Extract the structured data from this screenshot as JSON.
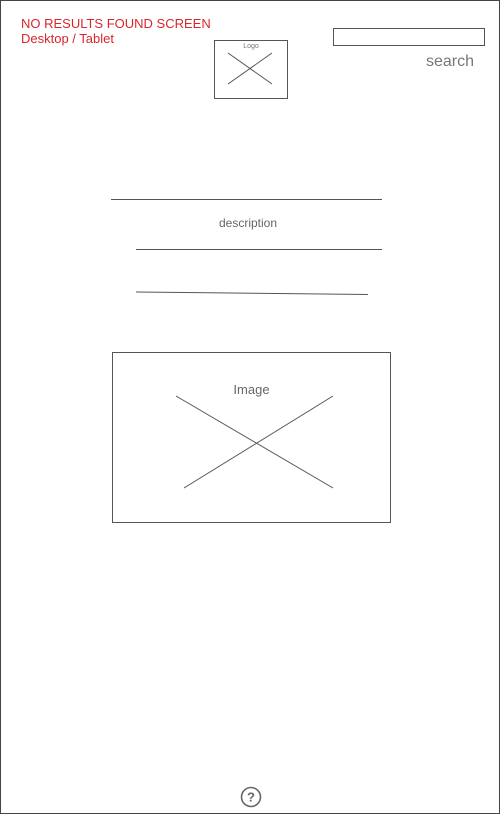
{
  "annotation": {
    "title": "NO RESULTS FOUND SCREEN",
    "subtitle": "Desktop / Tablet",
    "color": "#d9262c"
  },
  "header": {
    "logo_label": "Logo",
    "search_placeholder": "",
    "search_label": "search"
  },
  "main": {
    "description": "description",
    "image_label": "Image"
  },
  "footer": {
    "help_icon": "question-circle-icon",
    "help_glyph": "?"
  }
}
